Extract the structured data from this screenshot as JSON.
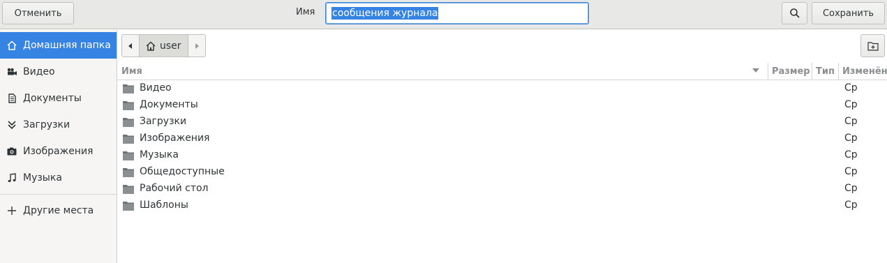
{
  "header": {
    "cancel_label": "Отменить",
    "name_label": "Имя",
    "name_value": "сообщения журнала",
    "save_label": "Сохранить"
  },
  "sidebar": {
    "items": [
      {
        "label": "Домашняя папка",
        "icon": "home-icon"
      },
      {
        "label": "Видео",
        "icon": "video-camera-icon"
      },
      {
        "label": "Документы",
        "icon": "document-icon"
      },
      {
        "label": "Загрузки",
        "icon": "download-icon"
      },
      {
        "label": "Изображения",
        "icon": "camera-icon"
      },
      {
        "label": "Музыка",
        "icon": "music-note-icon"
      }
    ],
    "other_places_label": "Другие места"
  },
  "pathbar": {
    "crumb": "user"
  },
  "columns": {
    "name": "Имя",
    "size": "Размер",
    "type": "Тип",
    "modified": "Изменён"
  },
  "files": [
    {
      "name": "Видео",
      "modified": "Ср"
    },
    {
      "name": "Документы",
      "modified": "Ср"
    },
    {
      "name": "Загрузки",
      "modified": "Ср"
    },
    {
      "name": "Изображения",
      "modified": "Ср"
    },
    {
      "name": "Музыка",
      "modified": "Ср"
    },
    {
      "name": "Общедоступные",
      "modified": "Ср"
    },
    {
      "name": "Рабочий стол",
      "modified": "Ср"
    },
    {
      "name": "Шаблоны",
      "modified": "Ср"
    }
  ],
  "colors": {
    "accent": "#3584e4",
    "header_bg": "#e8e8e7",
    "sidebar_bg": "#f6f5f4"
  }
}
